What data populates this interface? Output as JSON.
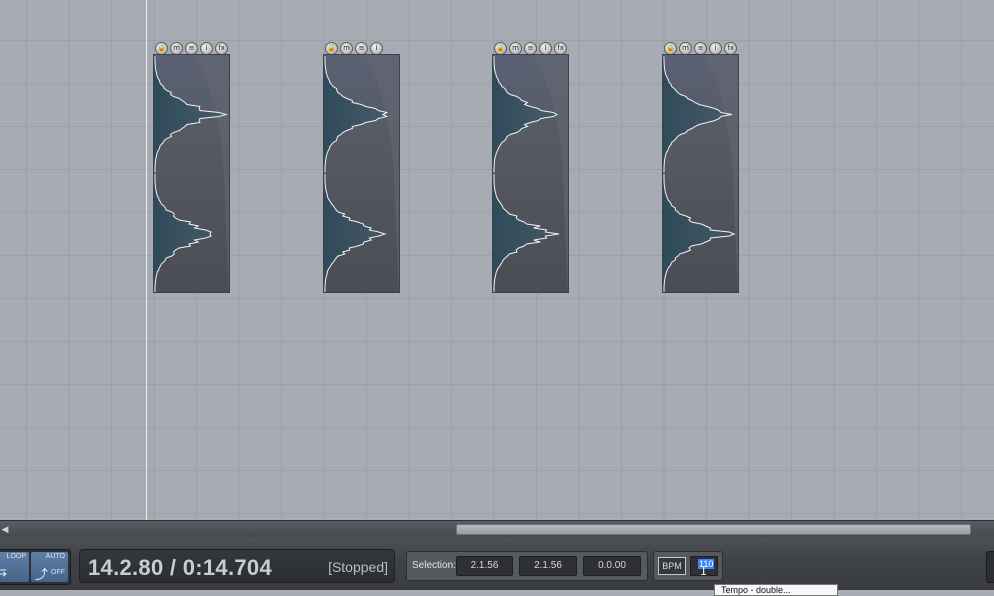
{
  "arrange": {
    "items": [
      {
        "buttons": [
          "lock",
          "m",
          "≡",
          "i",
          "fx"
        ]
      },
      {
        "buttons": [
          "lock",
          "m",
          "≡",
          "i"
        ]
      },
      {
        "buttons": [
          "lock",
          "m",
          "≡",
          "i",
          "fx"
        ]
      },
      {
        "buttons": [
          "lock",
          "m",
          "≡",
          "i",
          "fx"
        ]
      }
    ]
  },
  "transport": {
    "loop_label": "LOOP",
    "auto_label": "AUTO",
    "auto_state": "OFF",
    "time": "14.2.80 / 0:14.704",
    "status": "[Stopped]",
    "selection_label": "Selection:",
    "selection_start": "2.1.56",
    "selection_end": "2.1.56",
    "selection_length": "0.0.00",
    "bpm_label": "BPM",
    "bpm_value": "110",
    "tooltip": "Tempo - double..."
  },
  "colors": {
    "background": "#a7abb3",
    "item_fill": "#55585f",
    "wave": "#f0f2f4",
    "accent": "#3a86ff"
  }
}
